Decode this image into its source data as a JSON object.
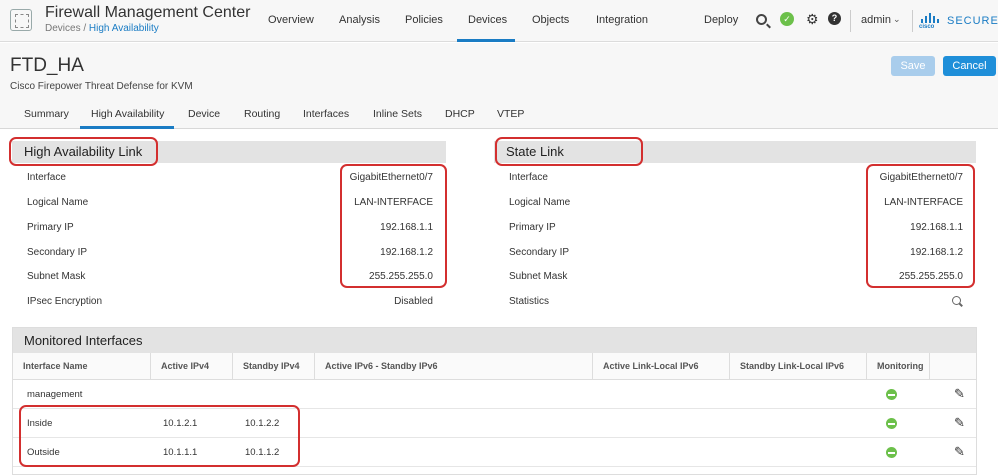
{
  "app": {
    "title": "Firewall Management Center",
    "crumb_devices": "Devices",
    "crumb_sep": " / ",
    "crumb_current": "High Availability"
  },
  "nav": {
    "items": [
      "Overview",
      "Analysis",
      "Policies",
      "Devices",
      "Objects",
      "Integration"
    ],
    "active": "Devices",
    "deploy": "Deploy",
    "user": "admin",
    "brand_small": "cisco",
    "brand": "SECURE"
  },
  "device": {
    "name": "FTD_HA",
    "subtitle": "Cisco Firepower Threat Defense for KVM",
    "save_label": "Save",
    "cancel_label": "Cancel"
  },
  "tabs": [
    "Summary",
    "High Availability",
    "Device",
    "Routing",
    "Interfaces",
    "Inline Sets",
    "DHCP",
    "VTEP"
  ],
  "active_tab": "High Availability",
  "ha_link": {
    "title": "High Availability Link",
    "rows": [
      {
        "label": "Interface",
        "value": "GigabitEthernet0/7"
      },
      {
        "label": "Logical Name",
        "value": "LAN-INTERFACE"
      },
      {
        "label": "Primary IP",
        "value": "192.168.1.1"
      },
      {
        "label": "Secondary IP",
        "value": "192.168.1.2"
      },
      {
        "label": "Subnet Mask",
        "value": "255.255.255.0"
      },
      {
        "label": "IPsec Encryption",
        "value": "Disabled"
      }
    ]
  },
  "state_link": {
    "title": "State Link",
    "rows": [
      {
        "label": "Interface",
        "value": "GigabitEthernet0/7"
      },
      {
        "label": "Logical Name",
        "value": "LAN-INTERFACE"
      },
      {
        "label": "Primary IP",
        "value": "192.168.1.1"
      },
      {
        "label": "Secondary IP",
        "value": "192.168.1.2"
      },
      {
        "label": "Subnet Mask",
        "value": "255.255.255.0"
      },
      {
        "label": "Statistics",
        "value": ""
      }
    ]
  },
  "monitored": {
    "title": "Monitored Interfaces",
    "columns": [
      "Interface Name",
      "Active IPv4",
      "Standby IPv4",
      "Active IPv6 - Standby IPv6",
      "Active Link-Local IPv6",
      "Standby Link-Local IPv6",
      "Monitoring"
    ],
    "rows": [
      {
        "name": "management",
        "active_ipv4": "",
        "standby_ipv4": ""
      },
      {
        "name": "Inside",
        "active_ipv4": "10.1.2.1",
        "standby_ipv4": "10.1.2.2"
      },
      {
        "name": "Outside",
        "active_ipv4": "10.1.1.1",
        "standby_ipv4": "10.1.1.2"
      }
    ]
  },
  "colors": {
    "accent": "#1a7cc4",
    "highlight": "#d32f2f",
    "status_ok": "#6cc04a"
  }
}
